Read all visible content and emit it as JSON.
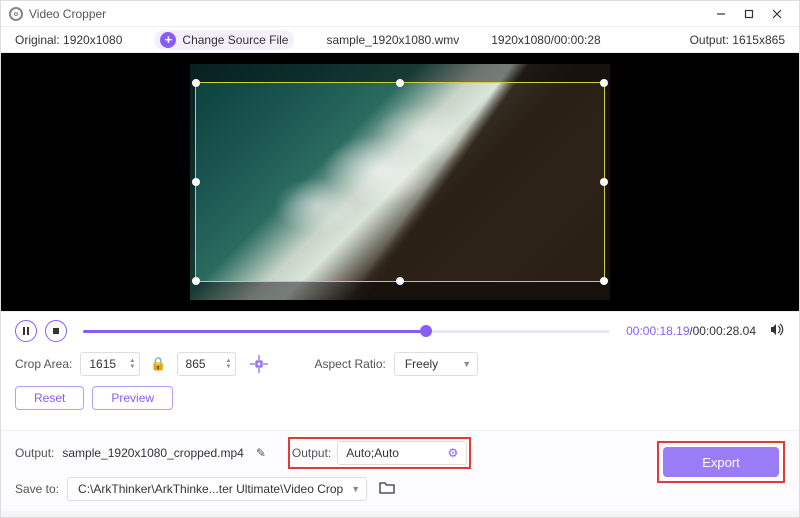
{
  "window": {
    "title": "Video Cropper"
  },
  "infobar": {
    "original": "Original:  1920x1080",
    "change_source": "Change Source File",
    "filename": "sample_1920x1080.wmv",
    "resolution_time": "1920x1080/00:00:28",
    "output": "Output:  1615x865"
  },
  "playback": {
    "current": "00:00:18.19",
    "total": "00:00:28.04"
  },
  "crop": {
    "label": "Crop Area:",
    "width": "1615",
    "height": "865",
    "aspect_label": "Aspect Ratio:",
    "aspect_value": "Freely"
  },
  "buttons": {
    "reset": "Reset",
    "preview": "Preview",
    "export": "Export"
  },
  "output": {
    "label": "Output:",
    "filename": "sample_1920x1080_cropped.mp4",
    "settings_label": "Output:",
    "settings_value": "Auto;Auto"
  },
  "save": {
    "label": "Save to:",
    "path": "C:\\ArkThinker\\ArkThinke...ter Ultimate\\Video Crop"
  }
}
